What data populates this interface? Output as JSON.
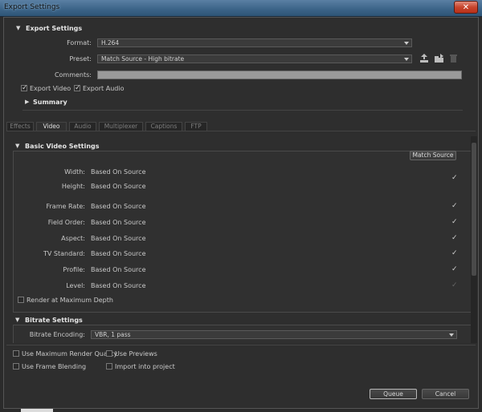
{
  "window": {
    "title": "Export Settings",
    "close_label": "✕"
  },
  "export_settings": {
    "header": "Export Settings",
    "format_label": "Format:",
    "format_value": "H.264",
    "preset_label": "Preset:",
    "preset_value": "Match Source - High bitrate",
    "comments_label": "Comments:",
    "comments_value": "",
    "export_video_label": "Export Video",
    "export_audio_label": "Export Audio",
    "summary_label": "Summary"
  },
  "tabs": [
    "Effects",
    "Video",
    "Audio",
    "Multiplexer",
    "Captions",
    "FTP"
  ],
  "basic_video": {
    "header": "Basic Video Settings",
    "match_source_label": "Match Source",
    "rows": [
      {
        "label": "Width:",
        "value": "Based On Source"
      },
      {
        "label": "Height:",
        "value": "Based On Source"
      },
      {
        "label": "Frame Rate:",
        "value": "Based On Source"
      },
      {
        "label": "Field Order:",
        "value": "Based On Source"
      },
      {
        "label": "Aspect:",
        "value": "Based On Source"
      },
      {
        "label": "TV Standard:",
        "value": "Based On Source"
      },
      {
        "label": "Profile:",
        "value": "Based On Source"
      },
      {
        "label": "Level:",
        "value": "Based On Source"
      }
    ],
    "render_max_depth_label": "Render at Maximum Depth"
  },
  "bitrate": {
    "header": "Bitrate Settings",
    "encoding_label": "Bitrate Encoding:",
    "encoding_value": "VBR, 1 pass"
  },
  "options": {
    "max_render_quality": "Use Maximum Render Quality",
    "use_previews": "Use Previews",
    "frame_blending": "Use Frame Blending",
    "import_into_project": "Import into project"
  },
  "footer": {
    "queue_label": "Queue",
    "cancel_label": "Cancel"
  }
}
